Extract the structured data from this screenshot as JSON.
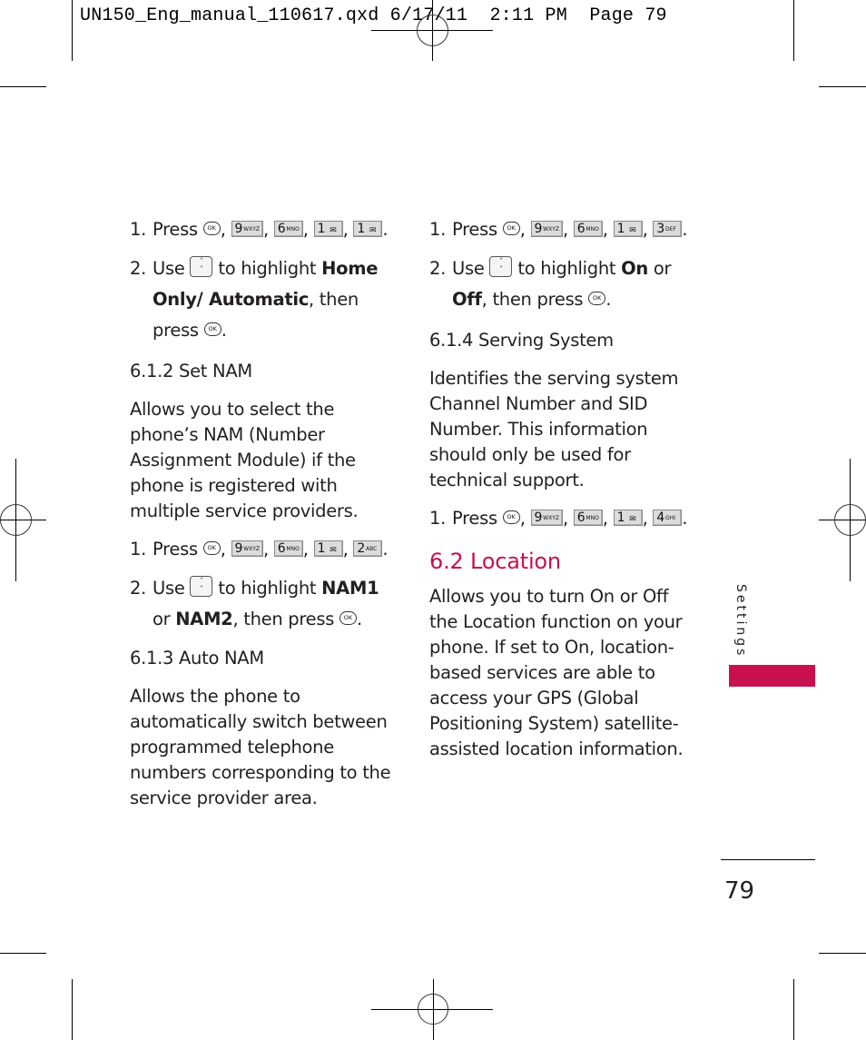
{
  "slug": {
    "filename": "UN150_Eng_manual_110617.qxd",
    "date": "6/17/11",
    "time": "2:11 PM",
    "page_label": "Page 79"
  },
  "keys": {
    "ok": "OK",
    "nav_up": "˄",
    "nav_down": "˅",
    "k9": {
      "digit": "9",
      "letters": "WXYZ"
    },
    "k6": {
      "digit": "6",
      "letters": "MNO"
    },
    "k1": {
      "digit": "1",
      "letters": "voicemail"
    },
    "k2": {
      "digit": "2",
      "letters": "ABC"
    },
    "k3": {
      "digit": "3",
      "letters": "DEF"
    },
    "k4": {
      "digit": "4",
      "letters": "GHI"
    },
    "vm_glyph": "✉"
  },
  "left_column": {
    "home_only": {
      "step1_num": "1.",
      "step1_text": "Press",
      "step2_num": "2.",
      "step2_pre": "Use",
      "step2_mid": "to highlight",
      "step2_bold1": "Home Only/ Automatic",
      "step2_post": ", then press"
    },
    "set_nam": {
      "heading": "6.1.2 Set NAM",
      "description": "Allows you to select the phone’s NAM (Number Assignment Module) if the phone is registered with multiple service providers.",
      "step1_num": "1.",
      "step1_text": "Press",
      "step2_num": "2.",
      "step2_pre": "Use",
      "step2_mid": "to highlight",
      "step2_bold1": "NAM1",
      "step2_or": "or",
      "step2_bold2": "NAM2",
      "step2_post": ", then press"
    },
    "auto_nam": {
      "heading": "6.1.3 Auto NAM",
      "description": "Allows the phone to automatically switch between programmed telephone numbers corresponding to the service provider area."
    }
  },
  "right_column": {
    "auto_nam_steps": {
      "step1_num": "1.",
      "step1_text": "Press",
      "step2_num": "2.",
      "step2_pre": "Use",
      "step2_mid": "to highlight",
      "step2_bold1": "On",
      "step2_or": "or",
      "step2_bold2": "Off",
      "step2_post": ", then press"
    },
    "serving_system": {
      "heading": "6.1.4 Serving System",
      "description": "Identifies the serving system Channel Number and SID Number. This information should only be used for technical support.",
      "step1_num": "1.",
      "step1_text": "Press"
    },
    "location": {
      "heading": "6.2 Location",
      "description": "Allows you to turn On or Off the Location function on your phone. If set to On, location-based services are able to access your GPS (Global Positioning System) satellite-assisted location information."
    }
  },
  "sidebar": {
    "section_label": "Settings",
    "accent_color": "#c8104e"
  },
  "footer": {
    "page_number": "79"
  }
}
